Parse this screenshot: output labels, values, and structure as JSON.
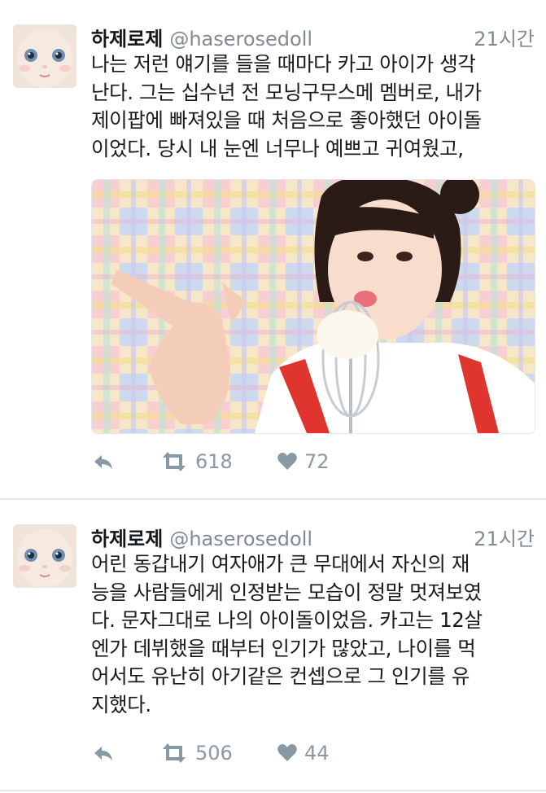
{
  "tweets": [
    {
      "display_name": "하제로제",
      "handle": "@haserosedoll",
      "time": "21시간",
      "text": "나는 저런 얘기를 들을 때마다 카고 아이가 생각\n난다. 그는 십수년 전 모닝구무스메 멤버로, 내가\n제이팝에 빠져있을 때 처음으로 좋아했던 아이돌\n이었다. 당시 내 눈엔 너무나 예쁘고 귀여웠고,",
      "retweets": "618",
      "likes": "72"
    },
    {
      "display_name": "하제로제",
      "handle": "@haserosedoll",
      "time": "21시간",
      "text": "어린 동갑내기 여자애가 큰 무대에서 자신의 재\n능을 사람들에게 인정받는 모습이 정말 멋져보였\n다. 문자그대로 나의 아이돌이었음. 카고는 12살\n엔가 데뷔했을 때부터 인기가 많았고, 나이를 먹\n어서도 유난히 아기같은 컨셉으로 그 인기를 유\n지했다.",
      "retweets": "506",
      "likes": "44"
    }
  ],
  "icons": {
    "reply": "reply-icon",
    "retweet": "retweet-icon",
    "like": "heart-icon"
  },
  "colors": {
    "icon_gray": "#8899a6",
    "meta_gray": "#7f8a94",
    "separator": "#e1e8ed"
  }
}
